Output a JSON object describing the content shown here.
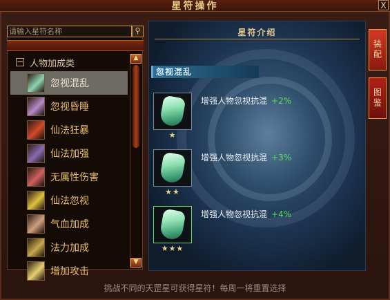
{
  "window": {
    "title": "星符操作",
    "close_label": "X"
  },
  "search": {
    "placeholder": "请输入星符名称",
    "button_icon": "search-icon"
  },
  "category": {
    "label": "人物加成类",
    "toggle": "−"
  },
  "list_items": [
    {
      "label": "忽视混乱",
      "selected": true,
      "icon_color": "#8fd3b0"
    },
    {
      "label": "忽视昏睡",
      "selected": false,
      "icon_color": "#b58ac6"
    },
    {
      "label": "仙法狂暴",
      "selected": false,
      "icon_color": "#d04a2a"
    },
    {
      "label": "仙法加强",
      "selected": false,
      "icon_color": "#8a6ab0"
    },
    {
      "label": "无属性伤害",
      "selected": false,
      "icon_color": "#d06060"
    },
    {
      "label": "仙法忽视",
      "selected": false,
      "icon_color": "#e0c040"
    },
    {
      "label": "气血加成",
      "selected": false,
      "icon_color": "#d0a080"
    },
    {
      "label": "法力加成",
      "selected": false,
      "icon_color": "#c8a84a"
    },
    {
      "label": "增加攻击",
      "selected": false,
      "icon_color": "#e6d070"
    }
  ],
  "scroll": {
    "up": "▲",
    "down": "▼"
  },
  "panel": {
    "title": "星符介绍",
    "banner": "忽视混乱",
    "ranks": [
      {
        "stars": "★",
        "text": "增强人物忽视抗混",
        "bonus": "+2%",
        "active": false
      },
      {
        "stars": "★★",
        "text": "增强人物忽视抗混",
        "bonus": "+3%",
        "active": false
      },
      {
        "stars": "★★★",
        "text": "增强人物忽视抗混",
        "bonus": "+4%",
        "active": true
      }
    ]
  },
  "tabs": [
    {
      "label": "装配",
      "active": true
    },
    {
      "label": "图鉴",
      "active": false
    }
  ],
  "footer": "挑战不同的天罡星可获得星符！每周一将重置选择"
}
